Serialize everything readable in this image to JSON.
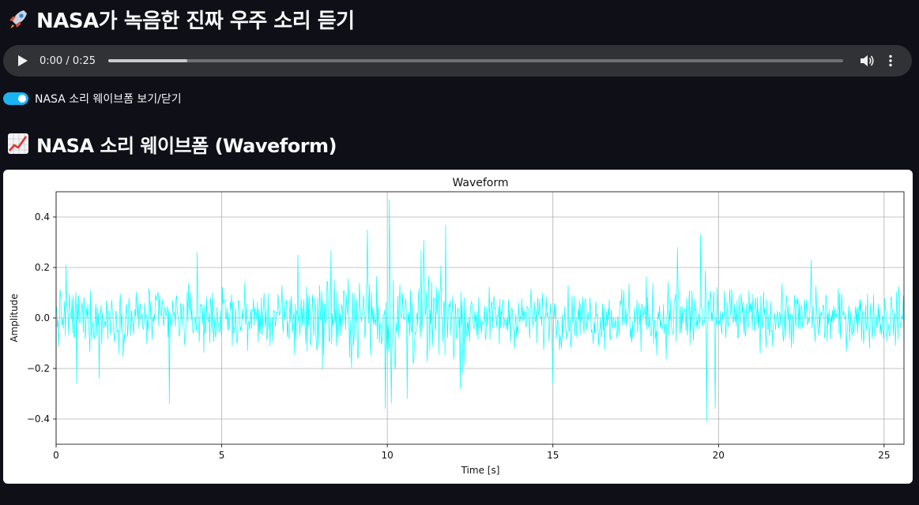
{
  "page": {
    "title": "NASA가 녹음한 진짜 우주 소리 듣기",
    "title_icon": "rocket-icon",
    "section_title": "NASA 소리 웨이브폼 (Waveform)",
    "section_icon": "chart-increasing-icon"
  },
  "audio_player": {
    "time_display": "0:00 / 0:25",
    "buffered_fraction": 0.108,
    "current_seconds": 0,
    "duration_seconds": 25
  },
  "toggle": {
    "label": "NASA 소리 웨이브폼 보기/닫기",
    "checked": true,
    "accent_color": "#1ab4f5"
  },
  "chart_data": {
    "type": "line",
    "title": "Waveform",
    "xlabel": "Time [s]",
    "ylabel": "Amplitude",
    "xlim": [
      0,
      25.6
    ],
    "ylim": [
      -0.5,
      0.5
    ],
    "xticks": [
      0,
      5,
      10,
      15,
      20,
      25
    ],
    "xtick_labels": [
      "0",
      "5",
      "10",
      "15",
      "20",
      "25"
    ],
    "yticks": [
      -0.4,
      -0.2,
      0.0,
      0.2,
      0.4
    ],
    "ytick_labels": [
      "−0.4",
      "−0.2",
      "0.0",
      "0.2",
      "0.4"
    ],
    "grid": true,
    "line_color": "#00ffff",
    "sample_rate_hz": 50,
    "spikes": [
      {
        "x": 0.3,
        "y": 0.21
      },
      {
        "x": 0.62,
        "y": -0.26
      },
      {
        "x": 1.3,
        "y": -0.24
      },
      {
        "x": 3.42,
        "y": -0.34
      },
      {
        "x": 4.25,
        "y": 0.26
      },
      {
        "x": 7.3,
        "y": 0.25
      },
      {
        "x": 8.3,
        "y": 0.27
      },
      {
        "x": 9.4,
        "y": 0.35
      },
      {
        "x": 9.93,
        "y": -0.36
      },
      {
        "x": 10.05,
        "y": 0.47
      },
      {
        "x": 10.12,
        "y": -0.34
      },
      {
        "x": 10.6,
        "y": -0.32
      },
      {
        "x": 11.1,
        "y": 0.31
      },
      {
        "x": 11.75,
        "y": 0.37
      },
      {
        "x": 12.2,
        "y": -0.28
      },
      {
        "x": 15.0,
        "y": -0.26
      },
      {
        "x": 18.75,
        "y": 0.28
      },
      {
        "x": 19.45,
        "y": 0.33
      },
      {
        "x": 19.65,
        "y": -0.41
      },
      {
        "x": 19.9,
        "y": -0.36
      },
      {
        "x": 22.8,
        "y": 0.23
      }
    ]
  }
}
